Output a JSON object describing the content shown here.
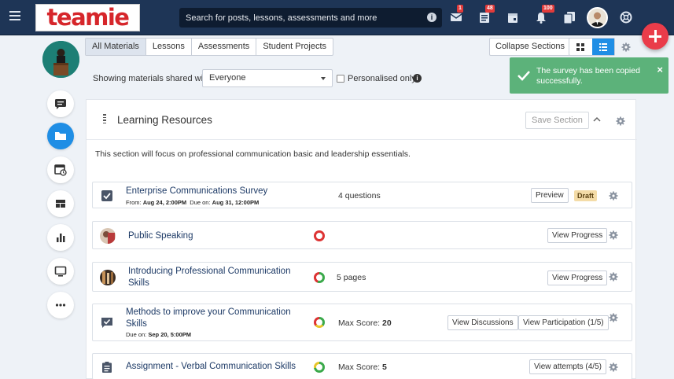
{
  "header": {
    "logo_text": "teamie",
    "search_placeholder": "Search for posts, lessons, assessments and more",
    "badges": {
      "messages": "1",
      "posts": "48",
      "notifications": "100"
    }
  },
  "tabs": [
    {
      "label": "All Materials",
      "active": true
    },
    {
      "label": "Lessons",
      "active": false
    },
    {
      "label": "Assessments",
      "active": false
    },
    {
      "label": "Student Projects",
      "active": false
    }
  ],
  "collapse_label": "Collapse Sections",
  "filter": {
    "label": "Showing materials shared with",
    "value": "Everyone",
    "personalised_label": "Personalised only"
  },
  "toast": {
    "message": "The survey has been copied successfully."
  },
  "section": {
    "title": "Learning Resources",
    "save_label": "Save Section",
    "description": "This section will focus on professional communication basic and leadership essentials."
  },
  "items": [
    {
      "title": "Enterprise Communications Survey",
      "from_label": "From:",
      "from": "Aug 24, 2:00PM",
      "due_label": "Due on:",
      "due": "Aug 31, 12:00PM",
      "meta": "4 questions",
      "button": "Preview",
      "status": "Draft"
    },
    {
      "title": "Public Speaking",
      "button": "View Progress"
    },
    {
      "title_line1": "Introducing Professional Communication",
      "title_line2": "Skills",
      "meta": "5 pages",
      "button": "View Progress"
    },
    {
      "title_line1": "Methods to improve your Communication",
      "title_line2": "Skills",
      "due_label": "Due on:",
      "due": "Sep 20, 5:00PM",
      "meta_label": "Max Score:",
      "meta_value": "20",
      "button1": "View Discussions",
      "button2": "View Participation (1/5)"
    },
    {
      "title": "Assignment - Verbal Communication Skills",
      "meta_label": "Max Score:",
      "meta_value": "5",
      "button": "View attempts (4/5)"
    }
  ],
  "colors": {
    "topbar": "#1e3556",
    "accent": "#1f8ee5",
    "fab": "#ea3c4a",
    "toast": "#5cb27a",
    "draft": "#f4dca8"
  }
}
